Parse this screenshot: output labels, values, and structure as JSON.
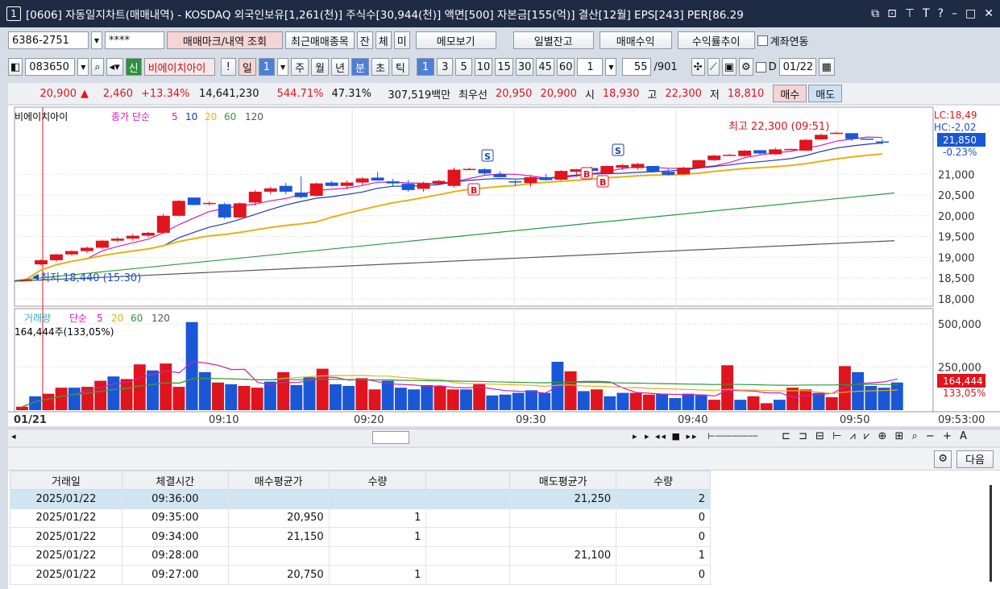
{
  "title": {
    "num": "1",
    "text": "[0606] 자동일지차트(매매내역) - KOSDAQ 외국인보유[1,261(천)] 주식수[30,944(천)] 액면[500] 자본금[155(억)] 결산[12월] EPS[243] PER[86.29"
  },
  "toolbar1": {
    "account": "6386-2751",
    "password": "****",
    "b1": "매매마크/내역 조회",
    "b2": "최근매매종목",
    "b3": "잔",
    "b4": "체",
    "b5": "미",
    "b6": "메모보기",
    "b7": "일별잔고",
    "b8": "매매수익",
    "b9": "수익률추이",
    "b10": "계좌연동"
  },
  "toolbar2": {
    "code": "083650",
    "sin": "신",
    "name": "비에이치아이",
    "excl": "!",
    "day": "일",
    "dayn": "1",
    "p": [
      "주",
      "월",
      "년",
      "분",
      "초",
      "틱"
    ],
    "mins": [
      "1",
      "3",
      "5",
      "10",
      "15",
      "30",
      "45",
      "60"
    ],
    "mval": "1",
    "count": "55",
    "total": "/901",
    "dlabel": "D",
    "date": "01/22"
  },
  "quote": {
    "price": "20,900",
    "arrow": "▲",
    "chg": "2,460",
    "pct": "+13.34%",
    "vol": "14,641,230",
    "vr": "544.71%",
    "rot": "47.31%",
    "amt": "307,519백만",
    "best": "최우선",
    "ask": "20,950",
    "bid": "20,900",
    "o_l": "시",
    "o": "18,930",
    "h_l": "고",
    "h": "22,300",
    "l_l": "저",
    "l": "18,810",
    "buy": "매수",
    "sell": "매도"
  },
  "chart_data": {
    "type": "candlestick",
    "price_legend": [
      "비에이치아이",
      "종가 단순",
      "5",
      "10",
      "20",
      "60",
      "120"
    ],
    "vol_legend": [
      "거래량",
      "단순",
      "5",
      "20",
      "60",
      "120"
    ],
    "vol_info": "164,444주(133,05%)",
    "high_label": "최고 22,300 (09:51)",
    "low_label": "최저 18,440 (15:30)",
    "lc": "LC:18,49",
    "hc": "HC:-2,02",
    "cur": "21,850",
    "cur_pct": "-0.23%",
    "vol_cur": "164,444",
    "vol_pct": "133,05%",
    "y_ticks": [
      "21,000",
      "20,500",
      "20,000",
      "19,500",
      "19,000",
      "18,500",
      "18,000"
    ],
    "y_ticks_v": [
      21000,
      20500,
      20000,
      19500,
      19000,
      18500,
      18000
    ],
    "vol_ticks": [
      "500,000",
      "250,000"
    ],
    "vol_ticks_v": [
      500000,
      250000
    ],
    "x_labels": [
      "01/21",
      "09:10",
      "09:20",
      "09:30",
      "09:40",
      "09:50",
      "09:53:00"
    ],
    "candles": [
      [
        18440,
        18480,
        18430,
        18460
      ],
      [
        18830,
        18960,
        18800,
        18930
      ],
      [
        18930,
        19080,
        18900,
        19070
      ],
      [
        19070,
        19170,
        19040,
        19150
      ],
      [
        19150,
        19260,
        19100,
        19230
      ],
      [
        19230,
        19420,
        19200,
        19400
      ],
      [
        19400,
        19490,
        19360,
        19450
      ],
      [
        19450,
        19560,
        19400,
        19520
      ],
      [
        19520,
        19610,
        19480,
        19590
      ],
      [
        19590,
        20050,
        19570,
        20000
      ],
      [
        20000,
        20380,
        19990,
        20360
      ],
      [
        20440,
        20390,
        20250,
        20260
      ],
      [
        20300,
        20350,
        20250,
        20310
      ],
      [
        20280,
        20320,
        19920,
        19960
      ],
      [
        19960,
        20320,
        19940,
        20300
      ],
      [
        20320,
        20620,
        20250,
        20580
      ],
      [
        20580,
        20700,
        20520,
        20660
      ],
      [
        20720,
        20790,
        20520,
        20580
      ],
      [
        20560,
        20950,
        20420,
        20450
      ],
      [
        20480,
        20800,
        20460,
        20780
      ],
      [
        20800,
        20840,
        20700,
        20720
      ],
      [
        20720,
        20850,
        20640,
        20800
      ],
      [
        20800,
        20930,
        20740,
        20900
      ],
      [
        20920,
        21060,
        20860,
        20850
      ],
      [
        20830,
        20890,
        20700,
        20780
      ],
      [
        20770,
        20860,
        20580,
        20620
      ],
      [
        20650,
        20820,
        20580,
        20780
      ],
      [
        20780,
        20860,
        20740,
        20840
      ],
      [
        20720,
        21160,
        20680,
        21110
      ],
      [
        21110,
        21160,
        21100,
        21130
      ],
      [
        21120,
        21140,
        20980,
        21020
      ],
      [
        21000,
        21070,
        20950,
        20930
      ],
      [
        20830,
        20860,
        20720,
        20800
      ],
      [
        20790,
        20980,
        20700,
        20930
      ],
      [
        20930,
        21010,
        20850,
        20860
      ],
      [
        20870,
        21100,
        20850,
        21080
      ],
      [
        21060,
        21130,
        20940,
        21120
      ],
      [
        21150,
        21180,
        21070,
        21080
      ],
      [
        21020,
        21210,
        21000,
        21200
      ],
      [
        21160,
        21250,
        21100,
        21220
      ],
      [
        21150,
        21280,
        21100,
        21250
      ],
      [
        21200,
        21190,
        21040,
        21070
      ],
      [
        21060,
        21140,
        20970,
        20990
      ],
      [
        21000,
        21180,
        20980,
        21160
      ],
      [
        21160,
        21350,
        21130,
        21340
      ],
      [
        21340,
        21470,
        21320,
        21450
      ],
      [
        21460,
        21490,
        21450,
        21470
      ],
      [
        21440,
        21580,
        21420,
        21570
      ],
      [
        21580,
        21550,
        21470,
        21500
      ],
      [
        21480,
        21640,
        21470,
        21600
      ],
      [
        21600,
        21620,
        21590,
        21610
      ],
      [
        21570,
        21850,
        21560,
        21830
      ],
      [
        21840,
        21970,
        21830,
        21950
      ],
      [
        21990,
        22020,
        21970,
        22000
      ],
      [
        21990,
        21960,
        21800,
        21850
      ],
      [
        21860,
        21860,
        21850,
        21850
      ],
      [
        21790,
        21850,
        21720,
        21780
      ]
    ],
    "volume": [
      20000,
      80000,
      95000,
      130000,
      130000,
      135000,
      170000,
      195000,
      180000,
      265000,
      230000,
      270000,
      135000,
      510000,
      220000,
      160000,
      150000,
      140000,
      130000,
      165000,
      220000,
      145000,
      190000,
      240000,
      150000,
      140000,
      185000,
      120000,
      170000,
      130000,
      120000,
      145000,
      140000,
      120000,
      120000,
      150000,
      85000,
      90000,
      100000,
      115000,
      100000,
      280000,
      225000,
      110000,
      120000,
      80000,
      100000,
      100000,
      90000,
      95000,
      70000,
      95000,
      90000,
      60000,
      260000,
      60000,
      80000,
      40000,
      60000,
      130000,
      120000,
      100000,
      75000,
      255000,
      220000,
      140000,
      130000,
      160000
    ],
    "trades": [
      {
        "type": "S",
        "time": "09:27"
      },
      {
        "type": "B",
        "time": "09:28"
      },
      {
        "type": "B",
        "time": "09:34"
      },
      {
        "type": "B",
        "time": "09:35"
      },
      {
        "type": "S",
        "time": "09:36"
      }
    ]
  },
  "scrollbar": {
    "icons": "▸ ◂◂ ■ ▸▸",
    "tools": "⊏ ⊐ ⊟ ⊢ ⩘ ⩗ ⊕ ⊞ ⌕ − + A"
  },
  "grid": {
    "next": "다음",
    "headers": [
      "거래일",
      "체결시간",
      "매수평균가",
      "수량",
      "",
      "매도평균가",
      "수량"
    ],
    "rows": [
      [
        "2025/01/22",
        "09:36:00",
        "",
        "",
        "",
        "21,250",
        "2"
      ],
      [
        "2025/01/22",
        "09:35:00",
        "20,950",
        "1",
        "",
        "",
        "0"
      ],
      [
        "2025/01/22",
        "09:34:00",
        "21,150",
        "1",
        "",
        "",
        "0"
      ],
      [
        "2025/01/22",
        "09:28:00",
        "",
        "",
        "",
        "21,100",
        "1"
      ],
      [
        "2025/01/22",
        "09:27:00",
        "20,750",
        "1",
        "",
        "",
        "0"
      ]
    ]
  },
  "colors": {
    "up": "#e0141e",
    "down": "#1a57d6",
    "ma5": "#d11fb8",
    "ma10": "#1f3ab8",
    "ma20": "#e8b015",
    "ma60": "#2a9a3a",
    "ma120": "#555555"
  }
}
